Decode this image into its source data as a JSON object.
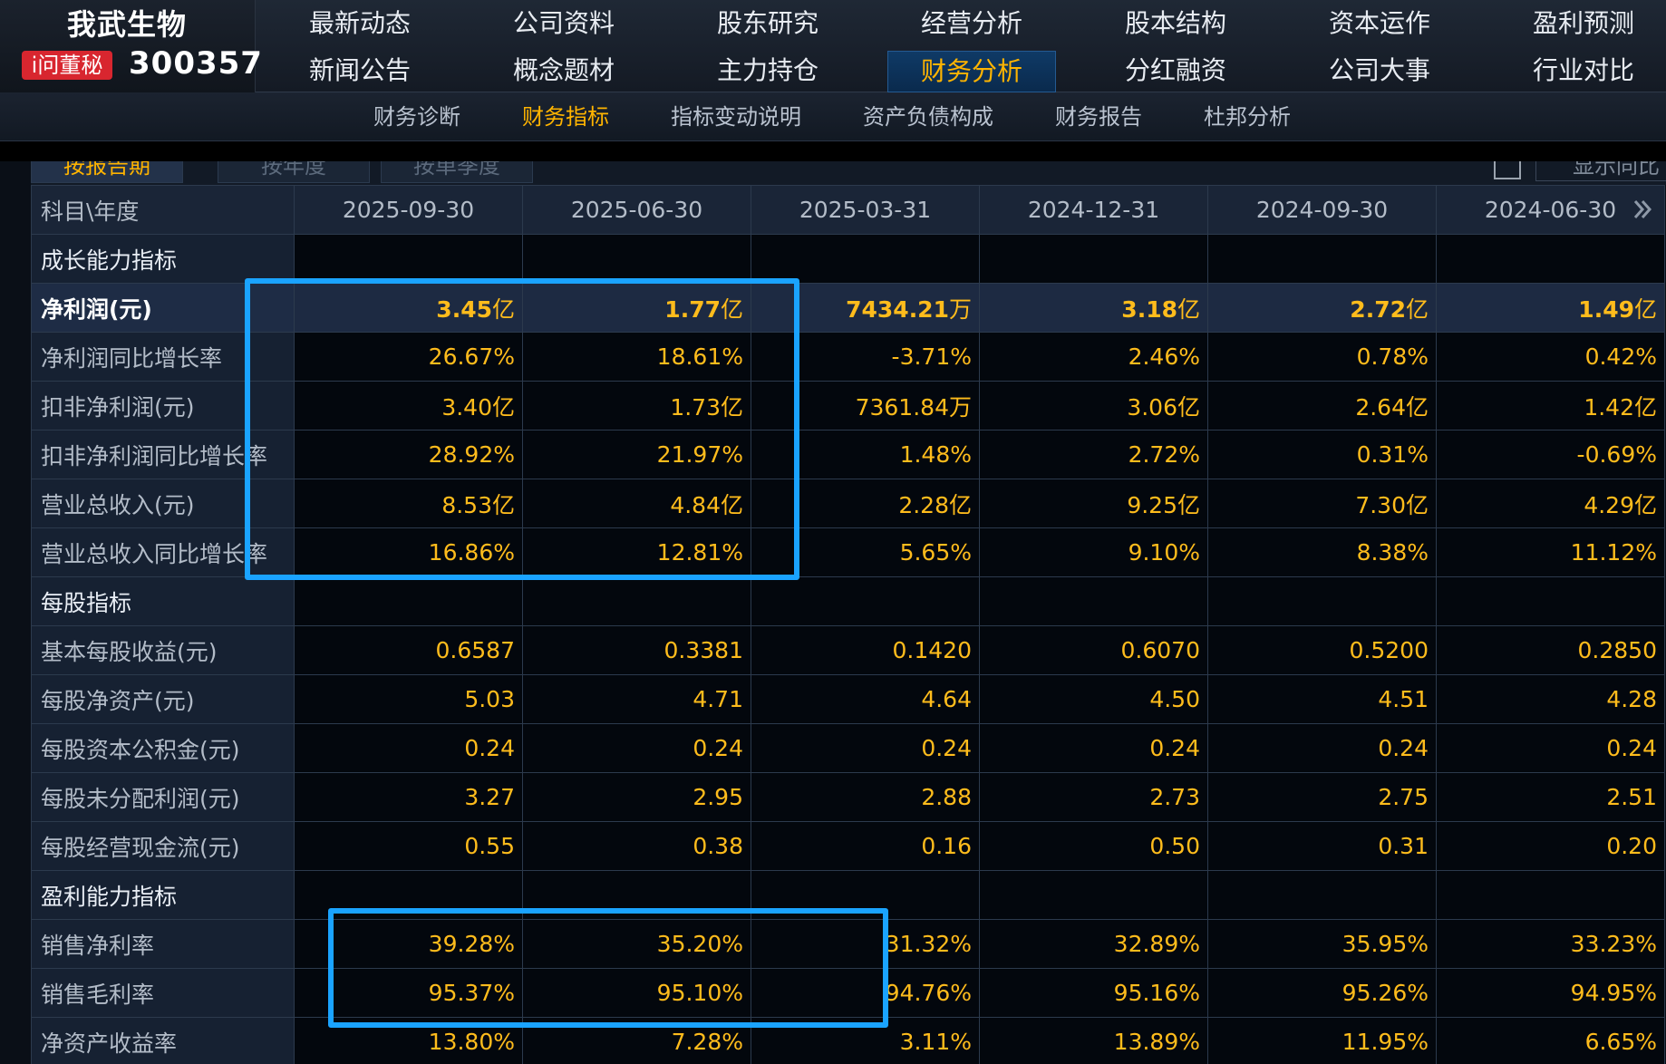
{
  "header": {
    "company_name": "我武生物",
    "badge": "i问董秘",
    "stock_code": "300357",
    "nav_row1": [
      "最新动态",
      "公司资料",
      "股东研究",
      "经营分析",
      "股本结构",
      "资本运作",
      "盈利预测"
    ],
    "nav_row2": [
      "新闻公告",
      "概念题材",
      "主力持仓",
      "财务分析",
      "分红融资",
      "公司大事",
      "行业对比"
    ],
    "nav_active": "财务分析"
  },
  "subnav": {
    "items": [
      "财务诊断",
      "财务指标",
      "指标变动说明",
      "资产负债构成",
      "财务报告",
      "杜邦分析"
    ],
    "active": "财务指标"
  },
  "period_tabs": [
    "按报告期",
    "按年度",
    "按单季度"
  ],
  "yoy_label": "显示同比",
  "table": {
    "header_label": "科目\\年度",
    "periods": [
      "2025-09-30",
      "2025-06-30",
      "2025-03-31",
      "2024-12-31",
      "2024-09-30",
      "2024-06-30"
    ],
    "rows": [
      {
        "type": "section",
        "label": "成长能力指标"
      },
      {
        "type": "data",
        "label": "净利润(元)",
        "highlight": true,
        "values": [
          [
            "3.45",
            "亿"
          ],
          [
            "1.77",
            "亿"
          ],
          [
            "7434.21",
            "万"
          ],
          [
            "3.18",
            "亿"
          ],
          [
            "2.72",
            "亿"
          ],
          [
            "1.49",
            "亿"
          ]
        ]
      },
      {
        "type": "data",
        "label": "净利润同比增长率",
        "values": [
          [
            "26.67%",
            ""
          ],
          [
            "18.61%",
            ""
          ],
          [
            "-3.71%",
            ""
          ],
          [
            "2.46%",
            ""
          ],
          [
            "0.78%",
            ""
          ],
          [
            "0.42%",
            ""
          ]
        ]
      },
      {
        "type": "data",
        "label": "扣非净利润(元)",
        "values": [
          [
            "3.40",
            "亿"
          ],
          [
            "1.73",
            "亿"
          ],
          [
            "7361.84",
            "万"
          ],
          [
            "3.06",
            "亿"
          ],
          [
            "2.64",
            "亿"
          ],
          [
            "1.42",
            "亿"
          ]
        ]
      },
      {
        "type": "data",
        "label": "扣非净利润同比增长率",
        "values": [
          [
            "28.92%",
            ""
          ],
          [
            "21.97%",
            ""
          ],
          [
            "1.48%",
            ""
          ],
          [
            "2.72%",
            ""
          ],
          [
            "0.31%",
            ""
          ],
          [
            "-0.69%",
            ""
          ]
        ]
      },
      {
        "type": "data",
        "label": "营业总收入(元)",
        "values": [
          [
            "8.53",
            "亿"
          ],
          [
            "4.84",
            "亿"
          ],
          [
            "2.28",
            "亿"
          ],
          [
            "9.25",
            "亿"
          ],
          [
            "7.30",
            "亿"
          ],
          [
            "4.29",
            "亿"
          ]
        ]
      },
      {
        "type": "data",
        "label": "营业总收入同比增长率",
        "values": [
          [
            "16.86%",
            ""
          ],
          [
            "12.81%",
            ""
          ],
          [
            "5.65%",
            ""
          ],
          [
            "9.10%",
            ""
          ],
          [
            "8.38%",
            ""
          ],
          [
            "11.12%",
            ""
          ]
        ]
      },
      {
        "type": "section",
        "label": "每股指标"
      },
      {
        "type": "data",
        "label": "基本每股收益(元)",
        "values": [
          [
            "0.6587",
            ""
          ],
          [
            "0.3381",
            ""
          ],
          [
            "0.1420",
            ""
          ],
          [
            "0.6070",
            ""
          ],
          [
            "0.5200",
            ""
          ],
          [
            "0.2850",
            ""
          ]
        ]
      },
      {
        "type": "data",
        "label": "每股净资产(元)",
        "values": [
          [
            "5.03",
            ""
          ],
          [
            "4.71",
            ""
          ],
          [
            "4.64",
            ""
          ],
          [
            "4.50",
            ""
          ],
          [
            "4.51",
            ""
          ],
          [
            "4.28",
            ""
          ]
        ]
      },
      {
        "type": "data",
        "label": "每股资本公积金(元)",
        "values": [
          [
            "0.24",
            ""
          ],
          [
            "0.24",
            ""
          ],
          [
            "0.24",
            ""
          ],
          [
            "0.24",
            ""
          ],
          [
            "0.24",
            ""
          ],
          [
            "0.24",
            ""
          ]
        ]
      },
      {
        "type": "data",
        "label": "每股未分配利润(元)",
        "values": [
          [
            "3.27",
            ""
          ],
          [
            "2.95",
            ""
          ],
          [
            "2.88",
            ""
          ],
          [
            "2.73",
            ""
          ],
          [
            "2.75",
            ""
          ],
          [
            "2.51",
            ""
          ]
        ]
      },
      {
        "type": "data",
        "label": "每股经营现金流(元)",
        "values": [
          [
            "0.55",
            ""
          ],
          [
            "0.38",
            ""
          ],
          [
            "0.16",
            ""
          ],
          [
            "0.50",
            ""
          ],
          [
            "0.31",
            ""
          ],
          [
            "0.20",
            ""
          ]
        ]
      },
      {
        "type": "section",
        "label": "盈利能力指标"
      },
      {
        "type": "data",
        "label": "销售净利率",
        "values": [
          [
            "39.28%",
            ""
          ],
          [
            "35.20%",
            ""
          ],
          [
            "31.32%",
            ""
          ],
          [
            "32.89%",
            ""
          ],
          [
            "35.95%",
            ""
          ],
          [
            "33.23%",
            ""
          ]
        ]
      },
      {
        "type": "data",
        "label": "销售毛利率",
        "values": [
          [
            "95.37%",
            ""
          ],
          [
            "95.10%",
            ""
          ],
          [
            "94.76%",
            ""
          ],
          [
            "95.16%",
            ""
          ],
          [
            "95.26%",
            ""
          ],
          [
            "94.95%",
            ""
          ]
        ]
      },
      {
        "type": "data",
        "label": "净资产收益率",
        "values": [
          [
            "13.80%",
            ""
          ],
          [
            "7.28%",
            ""
          ],
          [
            "3.11%",
            ""
          ],
          [
            "13.89%",
            ""
          ],
          [
            "11.95%",
            ""
          ],
          [
            "6.65%",
            ""
          ]
        ]
      }
    ]
  },
  "colors": {
    "value_text": "#ffbc1c",
    "active_nav": "#ffb400",
    "annotation": "#1aa3ff"
  },
  "icons": {
    "more_columns": "double-chevron-right-icon"
  }
}
